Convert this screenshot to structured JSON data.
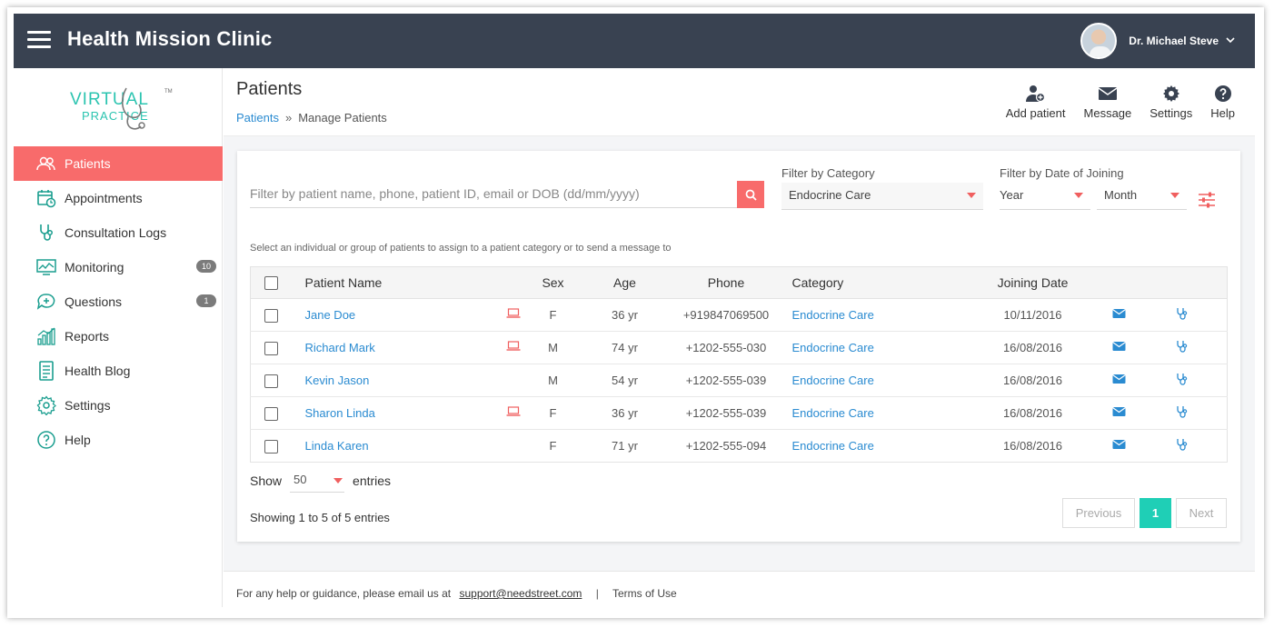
{
  "app": {
    "title": "Health Mission Clinic"
  },
  "user": {
    "name": "Dr. Michael Steve"
  },
  "logo": {
    "line1": "VIRTUAL",
    "line2": "PRACTICE",
    "tm": "TM"
  },
  "sidebar": {
    "items": [
      {
        "label": "Patients",
        "icon": "patients-icon",
        "active": true
      },
      {
        "label": "Appointments",
        "icon": "calendar-icon"
      },
      {
        "label": "Consultation Logs",
        "icon": "stethoscope-icon"
      },
      {
        "label": "Monitoring",
        "icon": "monitor-chart-icon",
        "badge": "10"
      },
      {
        "label": "Questions",
        "icon": "question-chat-icon",
        "badge": "1"
      },
      {
        "label": "Reports",
        "icon": "bar-chart-icon"
      },
      {
        "label": "Health Blog",
        "icon": "document-icon"
      },
      {
        "label": "Settings",
        "icon": "gear-icon"
      },
      {
        "label": "Help",
        "icon": "help-circle-icon"
      }
    ]
  },
  "page": {
    "title": "Patients",
    "breadcrumb": {
      "root": "Patients",
      "separator": "»",
      "current": "Manage Patients"
    }
  },
  "toolbar": {
    "add_patient": "Add patient",
    "message": "Message",
    "settings": "Settings",
    "help": "Help"
  },
  "filters": {
    "search_placeholder": "Filter by patient name, phone, patient ID, email or DOB (dd/mm/yyyy)",
    "category_label": "Filter by Category",
    "category_value": "Endocrine Care",
    "date_label": "Filter by Date of Joining",
    "year_value": "Year",
    "month_value": "Month",
    "hint": "Select an individual or group of patients to assign to a patient category or to send a message to"
  },
  "table": {
    "headers": {
      "name": "Patient Name",
      "sex": "Sex",
      "age": "Age",
      "phone": "Phone",
      "category": "Category",
      "joining": "Joining Date"
    },
    "rows": [
      {
        "name": "Jane Doe",
        "device": true,
        "sex": "F",
        "age": "36 yr",
        "phone": "+919847069500",
        "category": "Endocrine Care",
        "joining": "10/11/2016"
      },
      {
        "name": "Richard Mark",
        "device": true,
        "sex": "M",
        "age": "74 yr",
        "phone": "+1202-555-030",
        "category": "Endocrine Care",
        "joining": "16/08/2016"
      },
      {
        "name": "Kevin Jason",
        "device": false,
        "sex": "M",
        "age": "54 yr",
        "phone": "+1202-555-039",
        "category": "Endocrine Care",
        "joining": "16/08/2016"
      },
      {
        "name": "Sharon Linda",
        "device": true,
        "sex": "F",
        "age": "36 yr",
        "phone": "+1202-555-039",
        "category": "Endocrine Care",
        "joining": "16/08/2016"
      },
      {
        "name": "Linda Karen",
        "device": false,
        "sex": "F",
        "age": "71 yr",
        "phone": "+1202-555-094",
        "category": "Endocrine Care",
        "joining": "16/08/2016"
      }
    ]
  },
  "pagination": {
    "show_label": "Show",
    "page_size": "50",
    "entries_label": "entries",
    "showing_text": "Showing 1 to 5 of 5 entries",
    "previous": "Previous",
    "current_page": "1",
    "next": "Next"
  },
  "footer": {
    "help_text": "For any help or guidance, please email us at",
    "email": "support@needstreet.com",
    "separator": "|",
    "terms": "Terms of Use"
  },
  "colors": {
    "topbar": "#394251",
    "accent": "#f86b6b",
    "link": "#2a8bd1",
    "teal": "#1fcfb6"
  }
}
